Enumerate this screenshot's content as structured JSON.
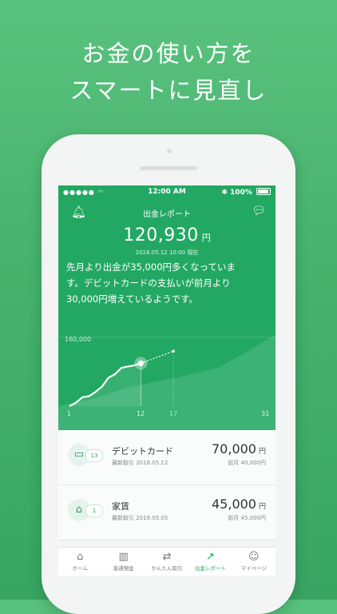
{
  "headline": {
    "line1": "お金の使い方を",
    "line2": "スマートに見直し"
  },
  "status_bar": {
    "time": "12:00 AM",
    "battery": "100%"
  },
  "header": {
    "title": "出金レポート",
    "amount": "120,930",
    "unit": "円",
    "date": "2018.05.12 10:00 現在"
  },
  "message": {
    "line1": "先月より出金が35,000円多くなっていま",
    "line2": "す。デビットカードの支払いが前月より",
    "line3": "30,000円増えているようです。"
  },
  "chart_data": {
    "type": "line",
    "ytick": "160,000",
    "x_ticks": [
      "1",
      "12",
      "17",
      "31"
    ],
    "series": [
      {
        "x": [
          1,
          2,
          3,
          4,
          5,
          6,
          7,
          8,
          9,
          10,
          11,
          12
        ],
        "values": [
          0,
          10000,
          25000,
          28000,
          40000,
          55000,
          80000,
          90000,
          108000,
          112000,
          115000,
          120930
        ]
      },
      {
        "x": [
          12,
          17
        ],
        "values": [
          120930,
          155000
        ],
        "style": "dashed-projection"
      }
    ],
    "ylim": [
      0,
      185000
    ],
    "xlim": [
      1,
      31
    ],
    "marker_day": 12,
    "grid": false
  },
  "items": [
    {
      "icon": "card-icon",
      "count": "13",
      "name": "デビットカード",
      "latest": "最新取引 2018.05.12",
      "amount": "70,000",
      "unit": "円",
      "prev": "前月 40,000円"
    },
    {
      "icon": "house-icon",
      "count": "1",
      "name": "家賃",
      "latest": "最新取引 2018.05.05",
      "amount": "45,000",
      "unit": "円",
      "prev": "前月 45,000円"
    }
  ],
  "tabs": [
    {
      "label": "ホーム",
      "icon": "home-icon"
    },
    {
      "label": "普通預金",
      "icon": "bar-chart-icon"
    },
    {
      "label": "かんたん取引",
      "icon": "exchange-icon"
    },
    {
      "label": "出金レポート",
      "icon": "trend-icon",
      "active": true
    },
    {
      "label": "マイページ",
      "icon": "user-icon"
    }
  ],
  "colors": {
    "brand": "#22a863",
    "background": "#46b26d"
  }
}
